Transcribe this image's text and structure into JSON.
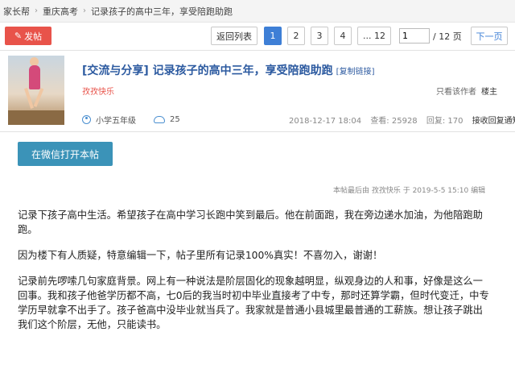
{
  "breadcrumb": [
    "家长帮",
    "重庆高考",
    "记录孩子的高中三年，享受陪跑助跑"
  ],
  "toolbar": {
    "post_label": "发帖",
    "back_list": "返回列表",
    "pages": [
      "1",
      "2",
      "3",
      "4",
      "... 12"
    ],
    "current_page": "1",
    "total_pages": "/ 12 页",
    "next": "下一页"
  },
  "thread": {
    "title": "[交流与分享] 记录孩子的高中三年，享受陪跑助跑",
    "copy_link": "[复制链接]",
    "author": "孜孜快乐",
    "only_author": "只看该作者",
    "owner": "楼主",
    "grade": "小学五年级",
    "credits": "25",
    "date": "2018-12-17 18:04",
    "views_label": "查看: 25928",
    "replies_label": "回复: 170",
    "notify": "接收回复通知"
  },
  "wechat_button": "在微信打开本帖",
  "edited_note": "本帖最后由 孜孜快乐 于 2019-5-5 15:10 编辑",
  "content": [
    "记录下孩子高中生活。希望孩子在高中学习长跑中笑到最后。他在前面跑，我在旁边递水加油，为他陪跑助跑。",
    "因为楼下有人质疑，特意编辑一下，帖子里所有记录100%真实！不喜勿入，谢谢！",
    "记录前先啰嗦几句家庭背景。网上有一种说法是阶层固化的现象越明显，纵观身边的人和事，好像是这么一回事。我和孩子他爸学历都不高，七0后的我当时初中毕业直接考了中专，那时还算学霸，但时代变迁，中专学历早就拿不出手了。孩子爸高中没毕业就当兵了。我家就是普通小县城里最普通的工薪族。想让孩子跳出我们这个阶层，无他，只能读书。"
  ],
  "colors": {
    "accent": "#e8534a",
    "link": "#2c5aa0",
    "active_page": "#3e7fd6",
    "wechat": "#3b93b8"
  }
}
